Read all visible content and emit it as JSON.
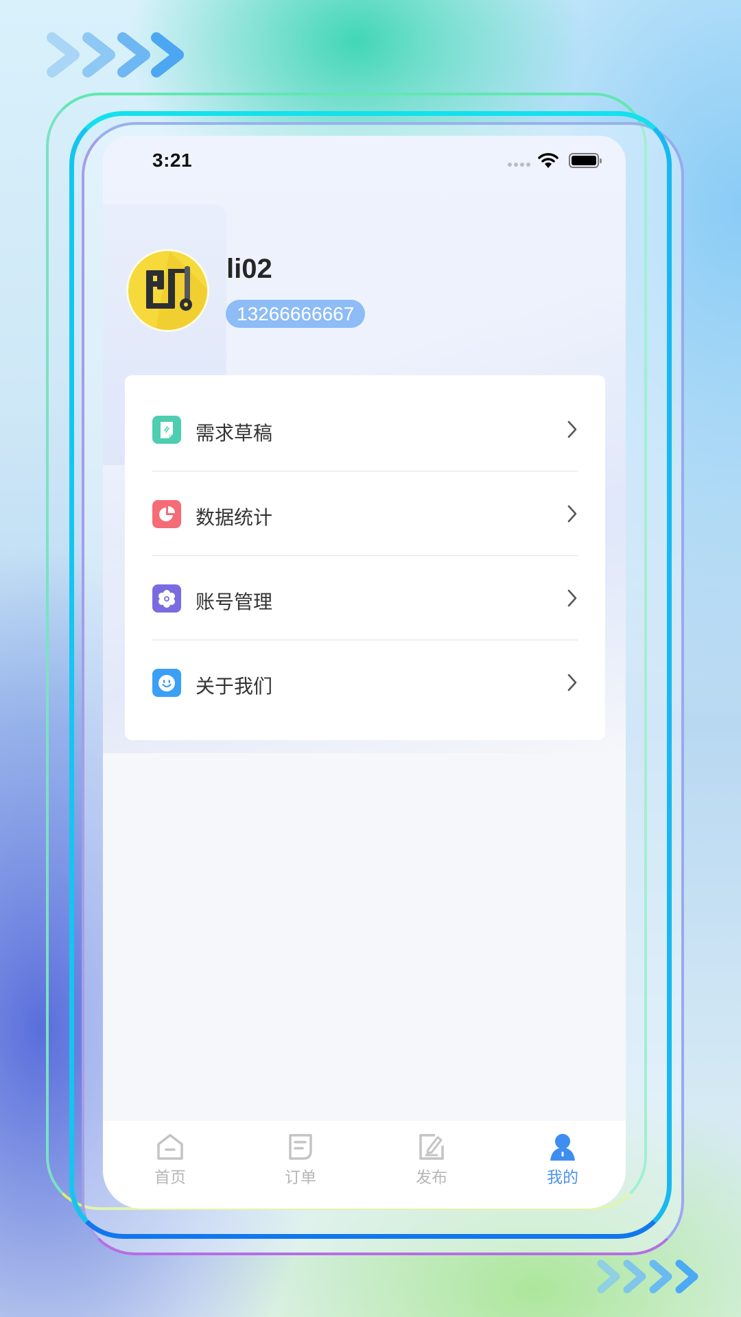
{
  "status_bar": {
    "time": "3:21"
  },
  "profile": {
    "name": "li02",
    "phone": "13266666667"
  },
  "menu": {
    "items": [
      {
        "label": "需求草稿",
        "icon": "draft-icon",
        "color": "#4ecdb0"
      },
      {
        "label": "数据统计",
        "icon": "pie-chart-icon",
        "color": "#f56c76"
      },
      {
        "label": "账号管理",
        "icon": "gear-icon",
        "color": "#7b6be0"
      },
      {
        "label": "关于我们",
        "icon": "smiley-icon",
        "color": "#3a9ff5"
      }
    ]
  },
  "tab_bar": {
    "tabs": [
      {
        "label": "首页",
        "icon": "home-icon",
        "active": false
      },
      {
        "label": "订单",
        "icon": "order-icon",
        "active": false
      },
      {
        "label": "发布",
        "icon": "publish-icon",
        "active": false
      },
      {
        "label": "我的",
        "icon": "user-icon",
        "active": true
      }
    ],
    "active_color": "#4b93ee",
    "inactive_color": "#b6b6b6"
  }
}
